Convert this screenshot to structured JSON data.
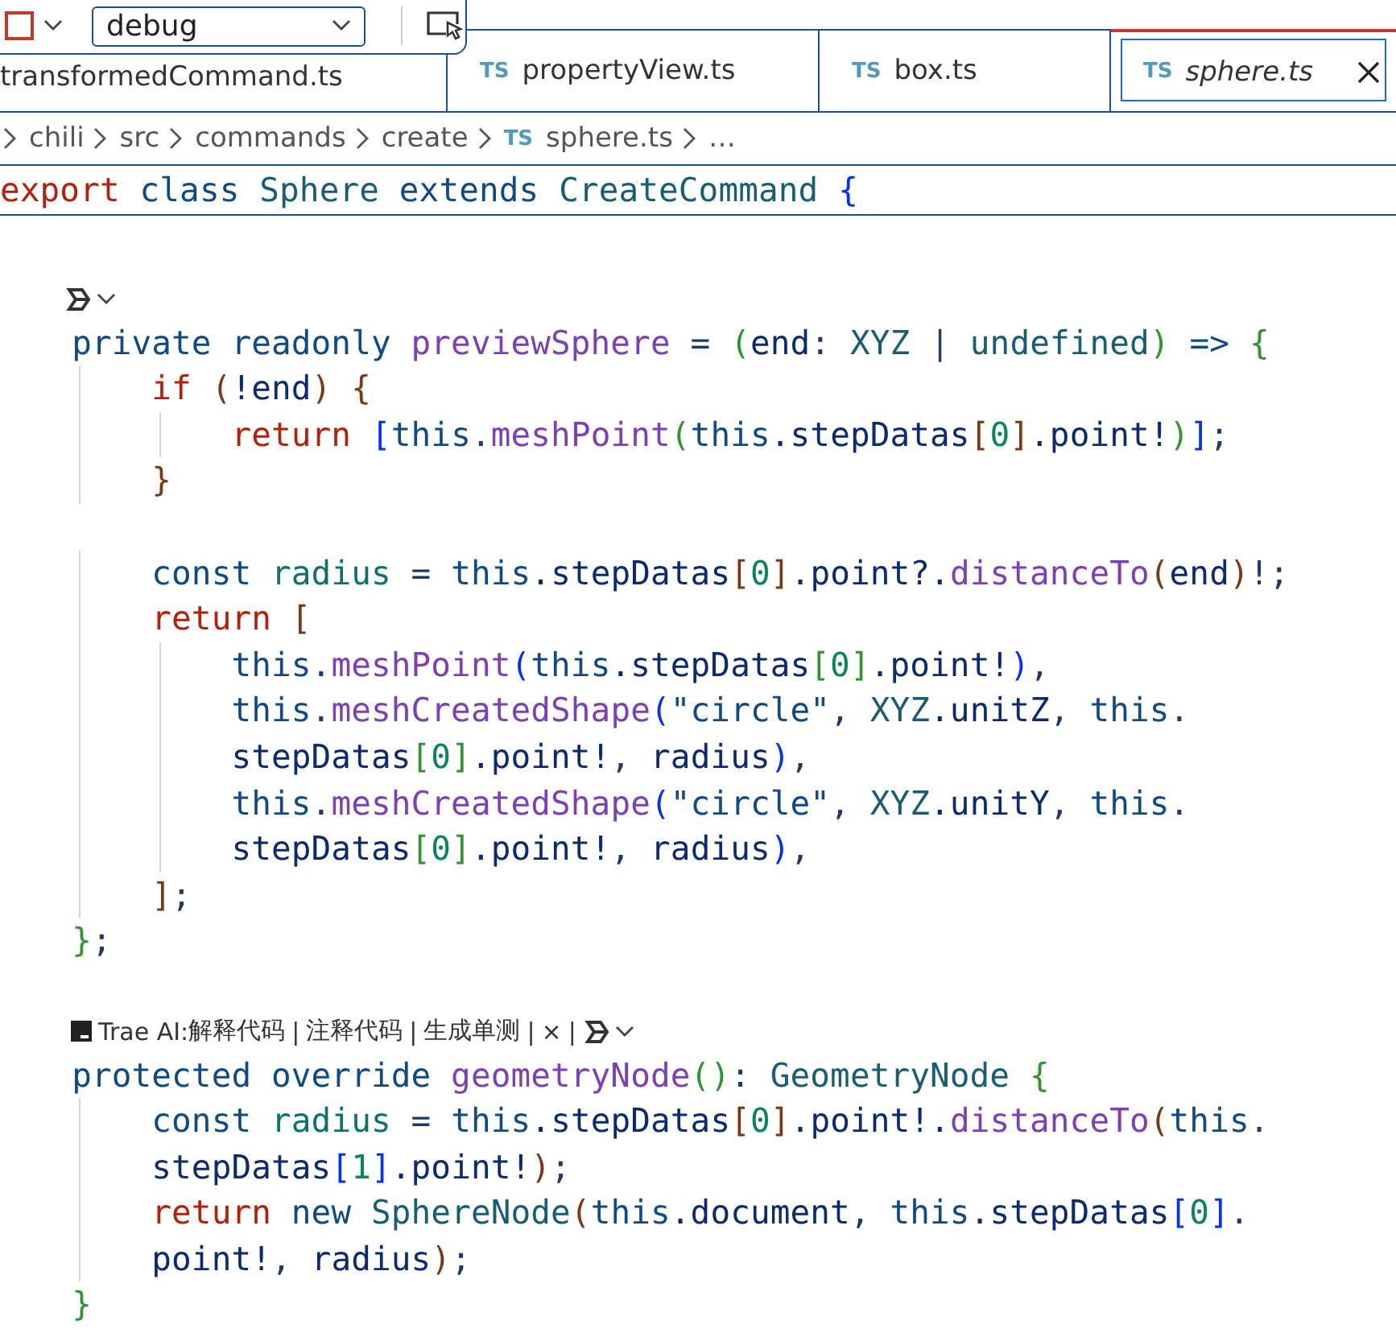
{
  "debug_toolbar": {
    "config": "debug"
  },
  "tabs": [
    {
      "label": "transformedCommand.ts",
      "selected": false,
      "italic": false
    },
    {
      "icon": "TS",
      "label": "propertyView.ts",
      "selected": false,
      "italic": false
    },
    {
      "icon": "TS",
      "label": "box.ts",
      "selected": false,
      "italic": false
    },
    {
      "icon": "TS",
      "label": "sphere.ts",
      "selected": true,
      "italic": true
    }
  ],
  "breadcrumb": [
    {
      "label": "chili"
    },
    {
      "label": "src"
    },
    {
      "label": "commands"
    },
    {
      "label": "create"
    },
    {
      "icon": "TS",
      "label": "sphere.ts"
    },
    {
      "label": "…"
    }
  ],
  "sticky_line": [
    {
      "kind": "ctl",
      "text": "export "
    },
    {
      "kind": "kw",
      "text": "class "
    },
    {
      "kind": "type",
      "text": "Sphere "
    },
    {
      "kind": "kw",
      "text": "extends "
    },
    {
      "kind": "type",
      "text": "CreateCommand "
    },
    {
      "kind": "b1",
      "text": "{"
    }
  ],
  "code": [
    {
      "kind": "partial"
    },
    {
      "kind": "empty"
    },
    {
      "kind": "lens"
    },
    {
      "kind": "code",
      "tokens": [
        {
          "kind": "kw",
          "text": "    private readonly "
        },
        {
          "kind": "fn",
          "text": "previewSphere"
        },
        {
          "kind": "plain",
          "text": " = "
        },
        {
          "kind": "b2",
          "text": "("
        },
        {
          "kind": "var",
          "text": "end"
        },
        {
          "kind": "plain",
          "text": ": "
        },
        {
          "kind": "type",
          "text": "XYZ"
        },
        {
          "kind": "plain",
          "text": " | "
        },
        {
          "kind": "type",
          "text": "undefined"
        },
        {
          "kind": "b2",
          "text": ")"
        },
        {
          "kind": "kw",
          "text": " => "
        },
        {
          "kind": "b2",
          "text": "{"
        }
      ]
    },
    {
      "kind": "code",
      "tokens": [
        {
          "kind": "ctl",
          "text": "        if "
        },
        {
          "kind": "b3",
          "text": "("
        },
        {
          "kind": "var",
          "text": "!end"
        },
        {
          "kind": "b3",
          "text": ") {"
        }
      ]
    },
    {
      "kind": "code",
      "tokens": [
        {
          "kind": "ctl",
          "text": "            return "
        },
        {
          "kind": "b1",
          "text": "["
        },
        {
          "kind": "kw",
          "text": "this"
        },
        {
          "kind": "plain",
          "text": "."
        },
        {
          "kind": "fn",
          "text": "meshPoint"
        },
        {
          "kind": "b2",
          "text": "("
        },
        {
          "kind": "kw",
          "text": "this"
        },
        {
          "kind": "var",
          "text": ".stepDatas"
        },
        {
          "kind": "b3",
          "text": "["
        },
        {
          "kind": "num",
          "text": "0"
        },
        {
          "kind": "b3",
          "text": "]"
        },
        {
          "kind": "var",
          "text": ".point!"
        },
        {
          "kind": "b2",
          "text": ")"
        },
        {
          "kind": "b1",
          "text": "]"
        },
        {
          "kind": "plain",
          "text": ";"
        }
      ]
    },
    {
      "kind": "code",
      "tokens": [
        {
          "kind": "b3",
          "text": "        }"
        }
      ]
    },
    {
      "kind": "empty"
    },
    {
      "kind": "code",
      "tokens": [
        {
          "kind": "kw",
          "text": "        const "
        },
        {
          "kind": "const",
          "text": "radius"
        },
        {
          "kind": "plain",
          "text": " = "
        },
        {
          "kind": "kw",
          "text": "this"
        },
        {
          "kind": "var",
          "text": ".stepDatas"
        },
        {
          "kind": "b3",
          "text": "["
        },
        {
          "kind": "num",
          "text": "0"
        },
        {
          "kind": "b3",
          "text": "]"
        },
        {
          "kind": "var",
          "text": ".point?."
        },
        {
          "kind": "fn",
          "text": "distanceTo"
        },
        {
          "kind": "b3",
          "text": "("
        },
        {
          "kind": "var",
          "text": "end"
        },
        {
          "kind": "b3",
          "text": ")"
        },
        {
          "kind": "plain",
          "text": "!;"
        }
      ]
    },
    {
      "kind": "code",
      "tokens": [
        {
          "kind": "ctl",
          "text": "        return "
        },
        {
          "kind": "b3",
          "text": "["
        }
      ]
    },
    {
      "kind": "code",
      "tokens": [
        {
          "kind": "kw",
          "text": "            this"
        },
        {
          "kind": "plain",
          "text": "."
        },
        {
          "kind": "fn",
          "text": "meshPoint"
        },
        {
          "kind": "b1",
          "text": "("
        },
        {
          "kind": "kw",
          "text": "this"
        },
        {
          "kind": "var",
          "text": ".stepDatas"
        },
        {
          "kind": "b2",
          "text": "["
        },
        {
          "kind": "num",
          "text": "0"
        },
        {
          "kind": "b2",
          "text": "]"
        },
        {
          "kind": "var",
          "text": ".point!"
        },
        {
          "kind": "b1",
          "text": ")"
        },
        {
          "kind": "plain",
          "text": ","
        }
      ]
    },
    {
      "kind": "code",
      "tokens": [
        {
          "kind": "kw",
          "text": "            this"
        },
        {
          "kind": "plain",
          "text": "."
        },
        {
          "kind": "fn",
          "text": "meshCreatedShape"
        },
        {
          "kind": "b1",
          "text": "("
        },
        {
          "kind": "str",
          "text": "\"circle\""
        },
        {
          "kind": "plain",
          "text": ", "
        },
        {
          "kind": "type",
          "text": "XYZ"
        },
        {
          "kind": "var",
          "text": ".unitZ"
        },
        {
          "kind": "plain",
          "text": ", "
        },
        {
          "kind": "kw",
          "text": "this"
        },
        {
          "kind": "plain",
          "text": "."
        }
      ]
    },
    {
      "kind": "code",
      "tokens": [
        {
          "kind": "var",
          "text": "            stepDatas"
        },
        {
          "kind": "b2",
          "text": "["
        },
        {
          "kind": "num",
          "text": "0"
        },
        {
          "kind": "b2",
          "text": "]"
        },
        {
          "kind": "var",
          "text": ".point!"
        },
        {
          "kind": "plain",
          "text": ", "
        },
        {
          "kind": "var",
          "text": "radius"
        },
        {
          "kind": "b1",
          "text": ")"
        },
        {
          "kind": "plain",
          "text": ","
        }
      ]
    },
    {
      "kind": "code",
      "tokens": [
        {
          "kind": "kw",
          "text": "            this"
        },
        {
          "kind": "plain",
          "text": "."
        },
        {
          "kind": "fn",
          "text": "meshCreatedShape"
        },
        {
          "kind": "b1",
          "text": "("
        },
        {
          "kind": "str",
          "text": "\"circle\""
        },
        {
          "kind": "plain",
          "text": ", "
        },
        {
          "kind": "type",
          "text": "XYZ"
        },
        {
          "kind": "var",
          "text": ".unitY"
        },
        {
          "kind": "plain",
          "text": ", "
        },
        {
          "kind": "kw",
          "text": "this"
        },
        {
          "kind": "plain",
          "text": "."
        }
      ]
    },
    {
      "kind": "code",
      "tokens": [
        {
          "kind": "var",
          "text": "            stepDatas"
        },
        {
          "kind": "b2",
          "text": "["
        },
        {
          "kind": "num",
          "text": "0"
        },
        {
          "kind": "b2",
          "text": "]"
        },
        {
          "kind": "var",
          "text": ".point!"
        },
        {
          "kind": "plain",
          "text": ", "
        },
        {
          "kind": "var",
          "text": "radius"
        },
        {
          "kind": "b1",
          "text": ")"
        },
        {
          "kind": "plain",
          "text": ","
        }
      ]
    },
    {
      "kind": "code",
      "tokens": [
        {
          "kind": "b3",
          "text": "        ]"
        },
        {
          "kind": "plain",
          "text": ";"
        }
      ]
    },
    {
      "kind": "code",
      "tokens": [
        {
          "kind": "b2",
          "text": "    }"
        },
        {
          "kind": "plain",
          "text": ";"
        }
      ]
    },
    {
      "kind": "empty"
    },
    {
      "kind": "lens",
      "items": [
        {
          "kind": "text",
          "text": "Trae AI:"
        },
        {
          "kind": "link",
          "text": "解释代码"
        },
        {
          "kind": "sep",
          "text": "|"
        },
        {
          "kind": "link",
          "text": "注释代码"
        },
        {
          "kind": "sep",
          "text": "|"
        },
        {
          "kind": "link",
          "text": "生成单测"
        },
        {
          "kind": "sep",
          "text": "|"
        },
        {
          "kind": "link",
          "text": "×"
        },
        {
          "kind": "sep",
          "text": "|"
        }
      ]
    },
    {
      "kind": "code",
      "tokens": [
        {
          "kind": "kw",
          "text": "    protected override "
        },
        {
          "kind": "fn",
          "text": "geometryNode"
        },
        {
          "kind": "b2",
          "text": "()"
        },
        {
          "kind": "plain",
          "text": ": "
        },
        {
          "kind": "type",
          "text": "GeometryNode "
        },
        {
          "kind": "b2",
          "text": "{"
        }
      ]
    },
    {
      "kind": "code",
      "tokens": [
        {
          "kind": "kw",
          "text": "        const "
        },
        {
          "kind": "const",
          "text": "radius"
        },
        {
          "kind": "plain",
          "text": " = "
        },
        {
          "kind": "kw",
          "text": "this"
        },
        {
          "kind": "var",
          "text": ".stepDatas"
        },
        {
          "kind": "b3",
          "text": "["
        },
        {
          "kind": "num",
          "text": "0"
        },
        {
          "kind": "b3",
          "text": "]"
        },
        {
          "kind": "var",
          "text": ".point!."
        },
        {
          "kind": "fn",
          "text": "distanceTo"
        },
        {
          "kind": "b3",
          "text": "("
        },
        {
          "kind": "kw",
          "text": "this"
        },
        {
          "kind": "plain",
          "text": "."
        }
      ]
    },
    {
      "kind": "code",
      "tokens": [
        {
          "kind": "var",
          "text": "        stepDatas"
        },
        {
          "kind": "b1",
          "text": "["
        },
        {
          "kind": "num",
          "text": "1"
        },
        {
          "kind": "b1",
          "text": "]"
        },
        {
          "kind": "var",
          "text": ".point!"
        },
        {
          "kind": "b3",
          "text": ")"
        },
        {
          "kind": "plain",
          "text": ";"
        }
      ]
    },
    {
      "kind": "code",
      "tokens": [
        {
          "kind": "ctl",
          "text": "        return "
        },
        {
          "kind": "kw",
          "text": "new "
        },
        {
          "kind": "type",
          "text": "SphereNode"
        },
        {
          "kind": "b3",
          "text": "("
        },
        {
          "kind": "kw",
          "text": "this"
        },
        {
          "kind": "var",
          "text": ".document"
        },
        {
          "kind": "plain",
          "text": ", "
        },
        {
          "kind": "kw",
          "text": "this"
        },
        {
          "kind": "var",
          "text": ".stepDatas"
        },
        {
          "kind": "b1",
          "text": "["
        },
        {
          "kind": "num",
          "text": "0"
        },
        {
          "kind": "b1",
          "text": "]"
        },
        {
          "kind": "plain",
          "text": "."
        }
      ]
    },
    {
      "kind": "code",
      "tokens": [
        {
          "kind": "var",
          "text": "        point!"
        },
        {
          "kind": "plain",
          "text": ", "
        },
        {
          "kind": "var",
          "text": "radius"
        },
        {
          "kind": "b3",
          "text": ")"
        },
        {
          "kind": "plain",
          "text": ";"
        }
      ]
    },
    {
      "kind": "code",
      "tokens": [
        {
          "kind": "b2",
          "text": "    }"
        }
      ]
    }
  ]
}
